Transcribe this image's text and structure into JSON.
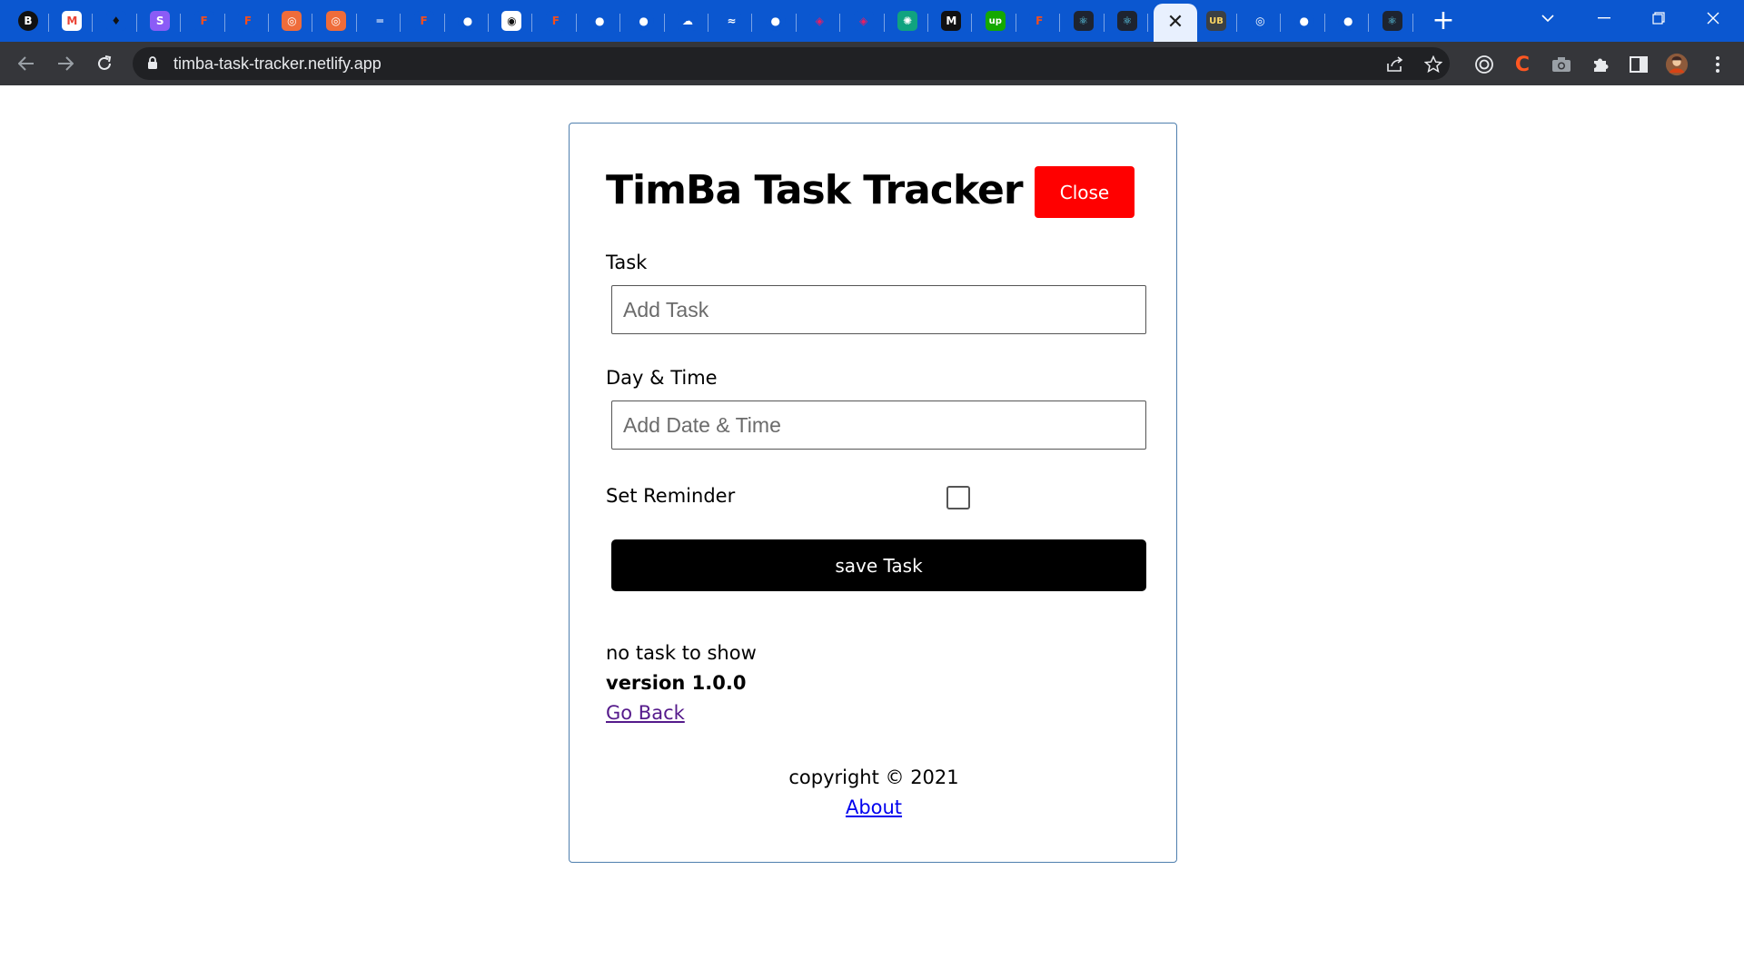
{
  "browser": {
    "url": "timba-task-tracker.netlify.app",
    "tab_bar_color": "#0b57d0",
    "active_tab_close": "✕",
    "new_tab_label": "+",
    "tabs": [
      {
        "icon": "bold-b-favicon-icon",
        "glyph": "B",
        "bg": "#111111",
        "fg": "#ffffff"
      },
      {
        "icon": "gmail-icon",
        "glyph": "M",
        "bg": "#ffffff",
        "fg": "#ea4335"
      },
      {
        "icon": "gem-favicon-icon",
        "glyph": "♦",
        "bg": "#0b57d0",
        "fg": "#111111"
      },
      {
        "icon": "s-purple-favicon-icon",
        "glyph": "S",
        "bg": "#8b5cf6",
        "fg": "#ffffff"
      },
      {
        "icon": "figma-icon",
        "glyph": "F",
        "bg": "#0b57d0",
        "fg": "#f24e1e"
      },
      {
        "icon": "figma-icon",
        "glyph": "F",
        "bg": "#0b57d0",
        "fg": "#f24e1e"
      },
      {
        "icon": "orange-circle-favicon-icon",
        "glyph": "◎",
        "bg": "#ef6c3a",
        "fg": "#ffffff"
      },
      {
        "icon": "orange-circle-favicon-icon",
        "glyph": "◎",
        "bg": "#ef6c3a",
        "fg": "#ffffff"
      },
      {
        "icon": "dash-favicon-icon",
        "glyph": "═",
        "bg": "#0b57d0",
        "fg": "#ffffff"
      },
      {
        "icon": "figma-icon",
        "glyph": "F",
        "bg": "#0b57d0",
        "fg": "#f24e1e"
      },
      {
        "icon": "github-icon",
        "glyph": "●",
        "bg": "#0b57d0",
        "fg": "#ffffff"
      },
      {
        "icon": "badge-favicon-icon",
        "glyph": "◉",
        "bg": "#ffffff",
        "fg": "#111111"
      },
      {
        "icon": "figma-icon",
        "glyph": "F",
        "bg": "#0b57d0",
        "fg": "#f24e1e"
      },
      {
        "icon": "github-icon",
        "glyph": "●",
        "bg": "#0b57d0",
        "fg": "#ffffff"
      },
      {
        "icon": "github-icon",
        "glyph": "●",
        "bg": "#0b57d0",
        "fg": "#ffffff"
      },
      {
        "icon": "cloud-favicon-icon",
        "glyph": "☁",
        "bg": "#0b57d0",
        "fg": "#ffffff"
      },
      {
        "icon": "tailwind-icon",
        "glyph": "≈",
        "bg": "#0b57d0",
        "fg": "#ffffff"
      },
      {
        "icon": "github-icon",
        "glyph": "●",
        "bg": "#0b57d0",
        "fg": "#ffffff"
      },
      {
        "icon": "layers-favicon-icon",
        "glyph": "◈",
        "bg": "#0b57d0",
        "fg": "#e91e63"
      },
      {
        "icon": "layers-favicon-icon",
        "glyph": "◈",
        "bg": "#0b57d0",
        "fg": "#e91e63"
      },
      {
        "icon": "chatgpt-icon",
        "glyph": "✺",
        "bg": "#10a37f",
        "fg": "#ffffff"
      },
      {
        "icon": "medium-icon",
        "glyph": "M",
        "bg": "#111111",
        "fg": "#ffffff"
      },
      {
        "icon": "upwork-icon",
        "glyph": "up",
        "bg": "#14a800",
        "fg": "#ffffff"
      },
      {
        "icon": "figma-icon",
        "glyph": "F",
        "bg": "#0b57d0",
        "fg": "#f24e1e"
      },
      {
        "icon": "react-icon",
        "glyph": "⚛",
        "bg": "#1e2430",
        "fg": "#61dafb"
      },
      {
        "icon": "react-icon",
        "glyph": "⚛",
        "bg": "#1e2430",
        "fg": "#61dafb"
      }
    ],
    "tabs_after_active": [
      {
        "icon": "ub-favicon-icon",
        "glyph": "UB",
        "bg": "#3c4043",
        "fg": "#fdd663"
      },
      {
        "icon": "chrome-icon",
        "glyph": "◎",
        "bg": "#0b57d0",
        "fg": "#ffffff"
      },
      {
        "icon": "github-icon",
        "glyph": "●",
        "bg": "#0b57d0",
        "fg": "#ffffff"
      },
      {
        "icon": "github-icon",
        "glyph": "●",
        "bg": "#0b57d0",
        "fg": "#ffffff"
      },
      {
        "icon": "react-icon",
        "glyph": "⚛",
        "bg": "#1e2430",
        "fg": "#61dafb"
      }
    ]
  },
  "app": {
    "title": "TimBa Task Tracker",
    "close_label": "Close",
    "close_color": "#ff0000",
    "task_label": "Task",
    "task_placeholder": "Add Task",
    "datetime_label": "Day & Time",
    "datetime_placeholder": "Add Date & Time",
    "reminder_label": "Set Reminder",
    "reminder_checked": false,
    "save_label": "save Task",
    "empty_message": "no task to show",
    "version": "version 1.0.0",
    "go_back": "Go Back",
    "copyright": "copyright © 2021",
    "about": "About"
  }
}
